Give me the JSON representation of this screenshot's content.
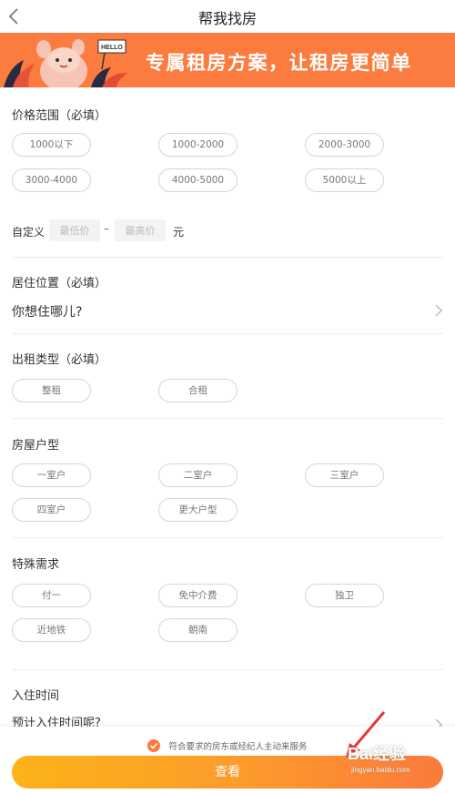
{
  "header": {
    "title": "帮我找房",
    "back_icon": "chevron-left-icon"
  },
  "banner": {
    "text": "专属租房方案，让租房更简单",
    "badge": "HELLO",
    "color": "#fb7c3e"
  },
  "price": {
    "title": "价格范围（必填）",
    "options": [
      "1000以下",
      "1000-2000",
      "2000-3000",
      "3000-4000",
      "4000-5000",
      "5000以上"
    ],
    "custom_label": "自定义",
    "min_placeholder": "最低价",
    "max_placeholder": "最高价",
    "dash": "–",
    "unit": "元"
  },
  "location": {
    "title": "居住位置（必填）",
    "placeholder": "你想住哪儿?"
  },
  "rent_type": {
    "title": "出租类型（必填）",
    "options": [
      "整租",
      "合租"
    ]
  },
  "room_type": {
    "title": "房屋户型",
    "options": [
      "一室户",
      "二室户",
      "三室户",
      "四室户",
      "更大户型"
    ]
  },
  "special": {
    "title": "特殊需求",
    "options": [
      "付一",
      "免中介费",
      "独卫",
      "近地铁",
      "朝南"
    ]
  },
  "move_in": {
    "title": "入住时间",
    "placeholder": "预计入住时间呢?"
  },
  "footer": {
    "agree_text": "符合要求的房东或经纪人主动来服务",
    "submit_label": "查看",
    "accent_color": "#fb7a3c"
  },
  "watermark": {
    "logo": "Bai经验",
    "site": "jingyan.baidu.com"
  }
}
